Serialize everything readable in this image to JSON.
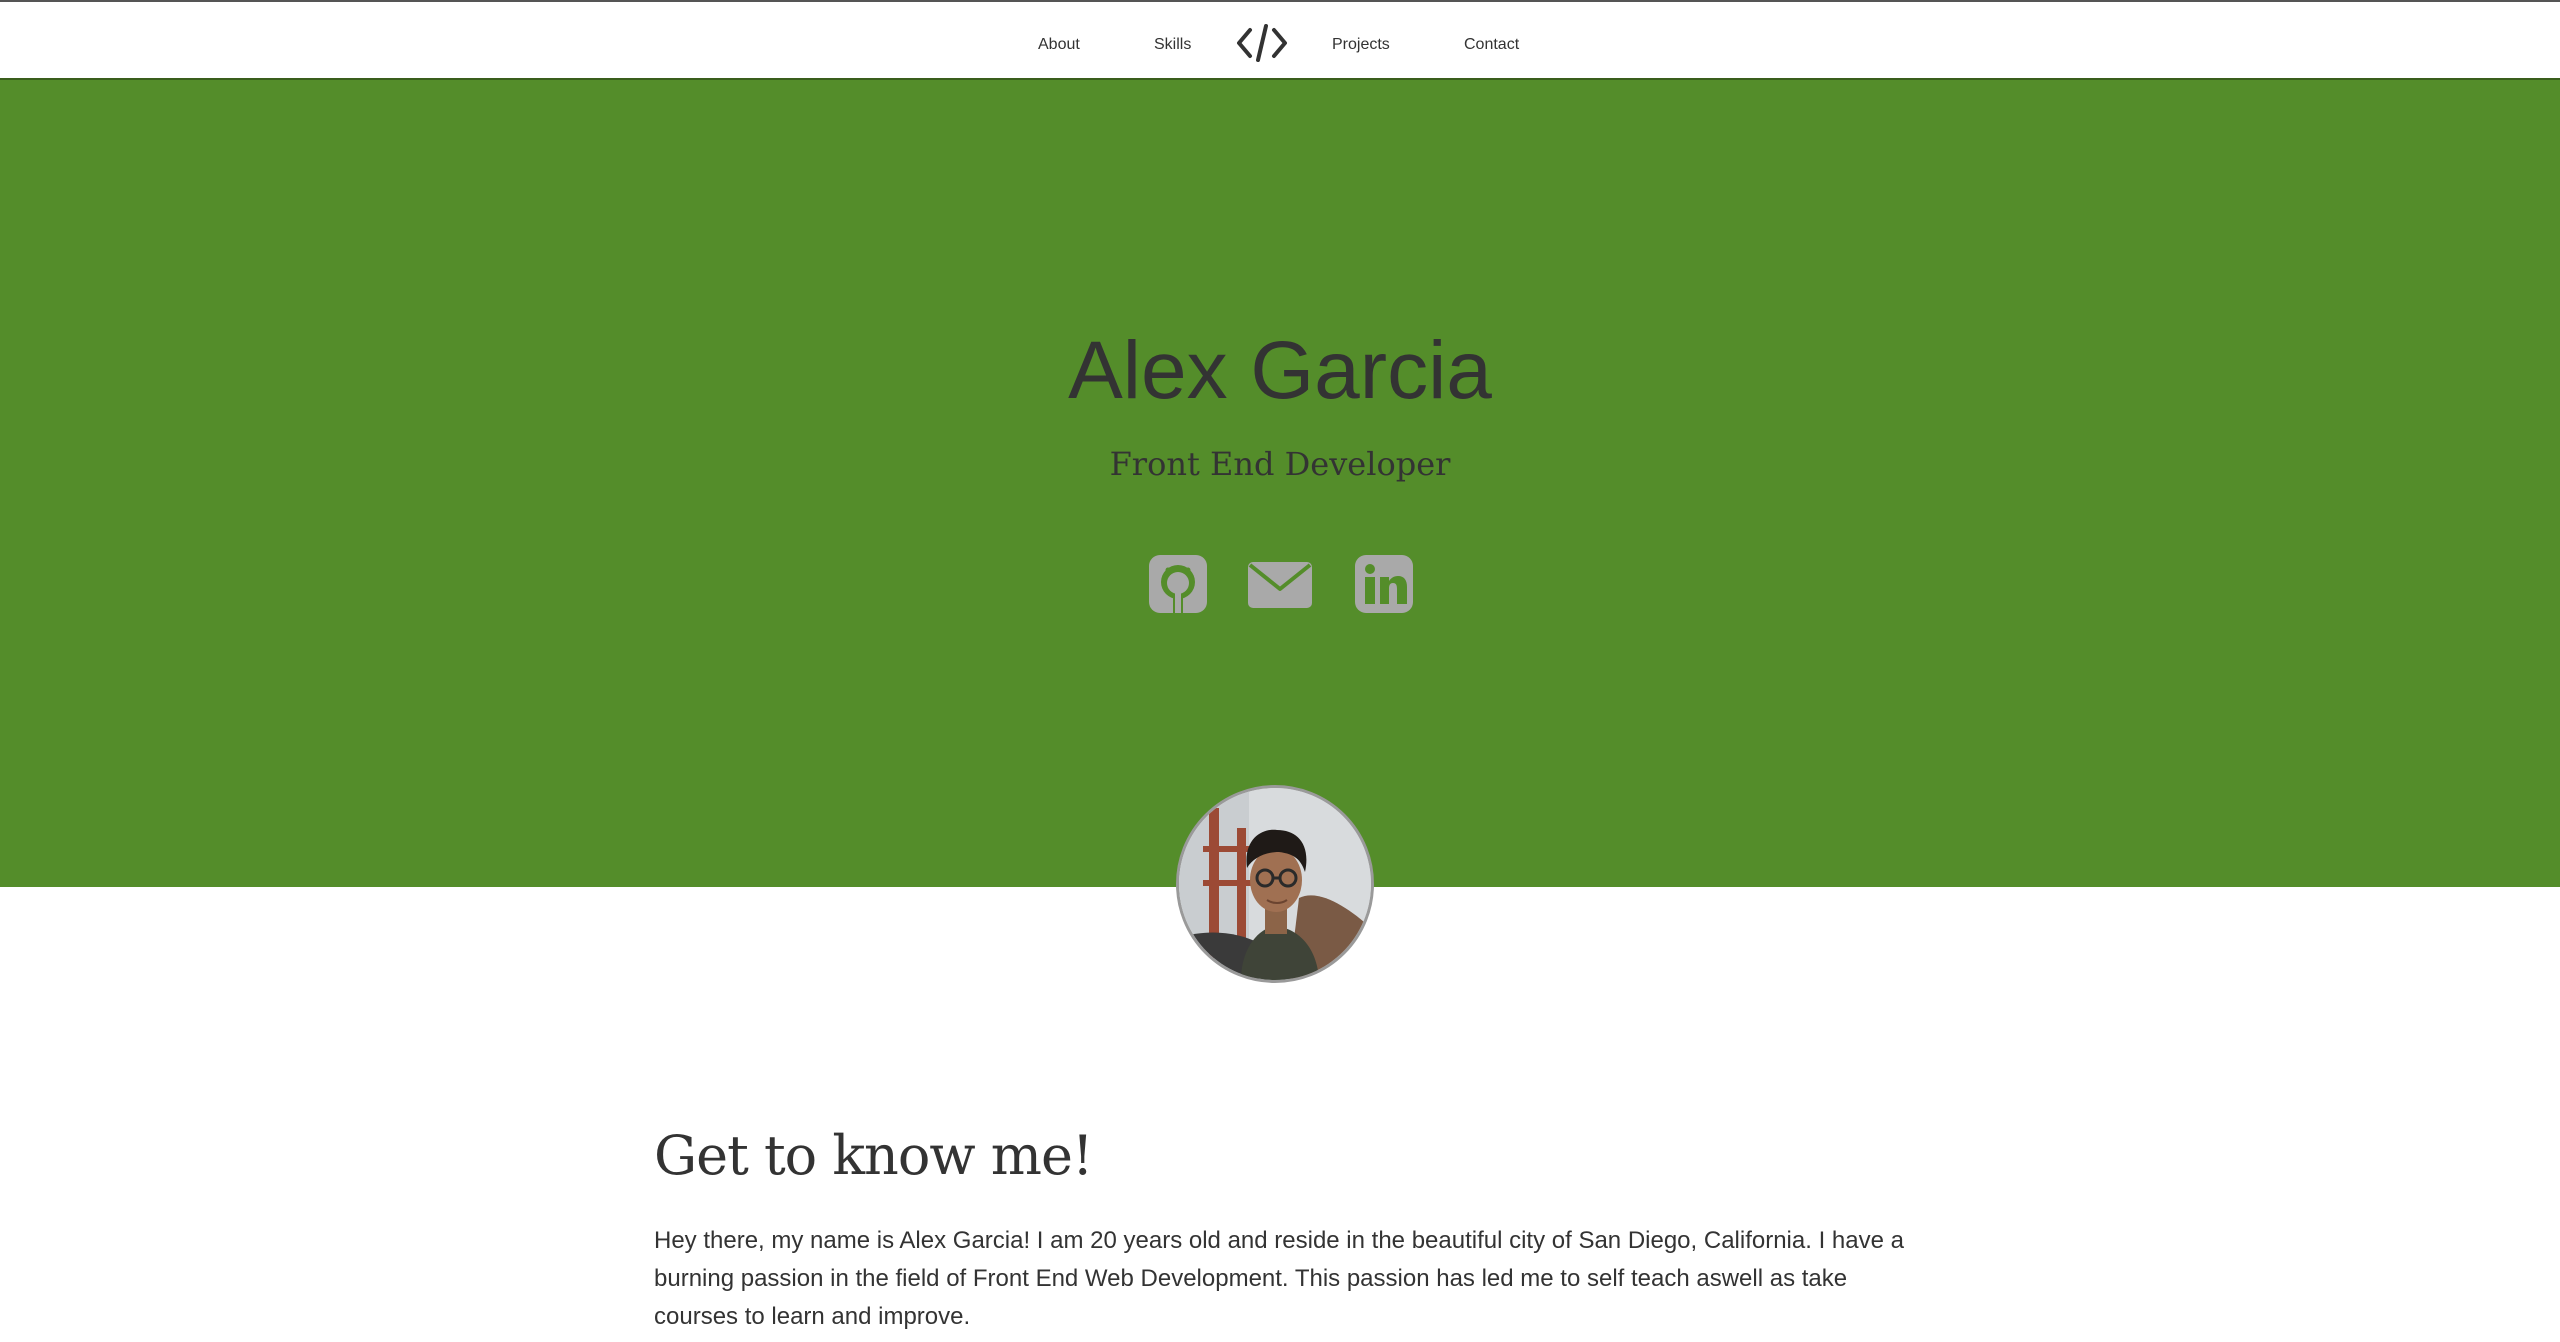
{
  "nav": {
    "items": [
      {
        "label": "About"
      },
      {
        "label": "Skills"
      },
      {
        "label": "Projects"
      },
      {
        "label": "Contact"
      }
    ],
    "logo_icon": "code-brackets-icon"
  },
  "hero": {
    "name": "Alex Garcia",
    "subtitle": "Front End Developer",
    "background_color": "#548d2a",
    "social_icons": [
      "github-icon",
      "envelope-icon",
      "linkedin-icon"
    ],
    "icon_color": "#a9a9a9"
  },
  "about": {
    "heading": "Get to know me!",
    "paragraph": "Hey there, my name is Alex Garcia! I am 20 years old and reside in the beautiful city of San Diego, California. I have a burning passion in the field of Front End Web Development. This passion has led me to self teach aswell as take courses to learn and improve."
  }
}
